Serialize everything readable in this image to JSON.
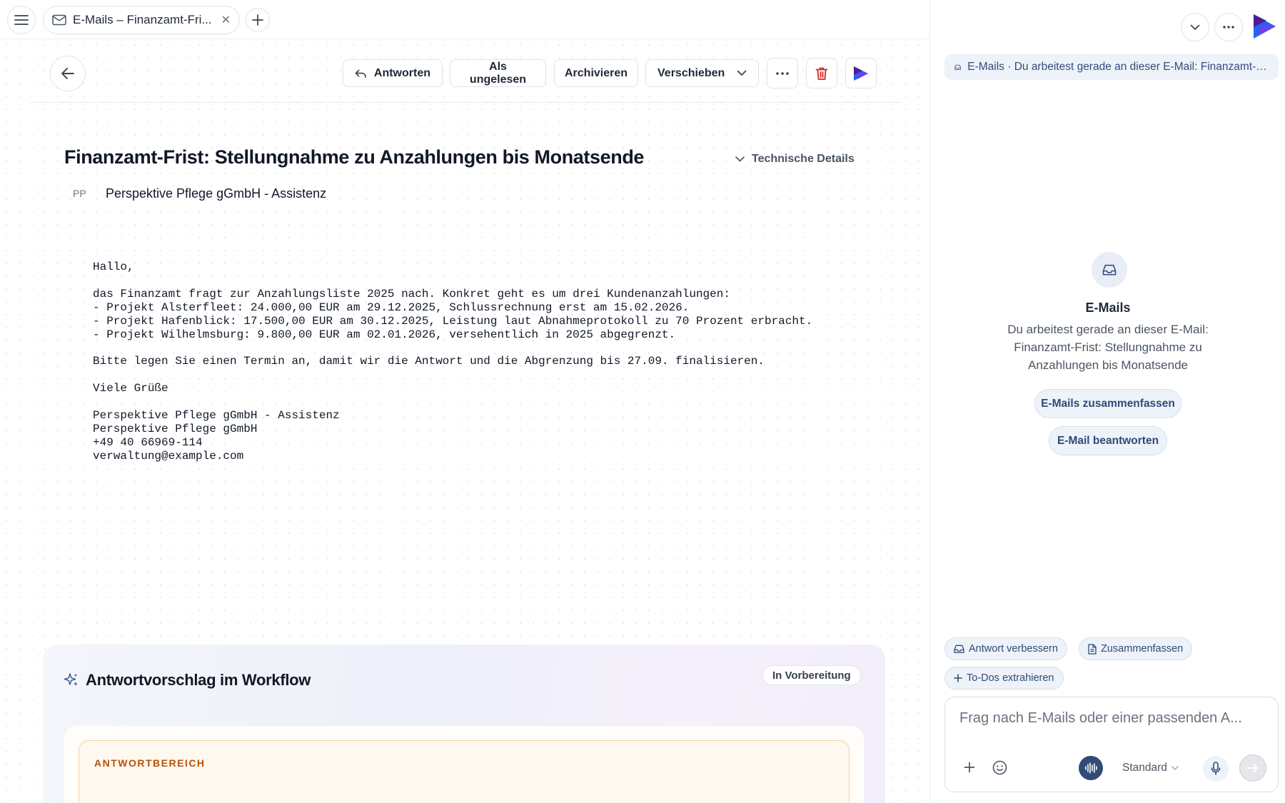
{
  "tabbar": {
    "tab_title": "E-Mails – Finanzamt-Fri..."
  },
  "toolbar": {
    "reply_label": "Antworten",
    "mark_unread_label": "Als ungelesen",
    "archive_label": "Archivieren",
    "move_label": "Verschieben"
  },
  "email": {
    "subject": "Finanzamt-Frist: Stellungnahme zu Anzahlungen bis Monatsende",
    "technical_details_label": "Technische Details",
    "sender_initials": "PP",
    "sender_name": "Perspektive Pflege gGmbH - Assistenz",
    "body": "Hallo,\n\ndas Finanzamt fragt zur Anzahlungsliste 2025 nach. Konkret geht es um drei Kundenanzahlungen:\n- Projekt Alsterfleet: 24.000,00 EUR am 29.12.2025, Schlussrechnung erst am 15.02.2026.\n- Projekt Hafenblick: 17.500,00 EUR am 30.12.2025, Leistung laut Abnahmeprotokoll zu 70 Prozent erbracht.\n- Projekt Wilhelmsburg: 9.800,00 EUR am 02.01.2026, versehentlich in 2025 abgegrenzt.\n\nBitte legen Sie einen Termin an, damit wir die Antwort und die Abgrenzung bis 27.09. finalisieren.\n\nViele Grüße\n\nPerspektive Pflege gGmbH - Assistenz\nPerspektive Pflege gGmbH\n+49 40 66969-114\nverwaltung@example.com"
  },
  "workflow": {
    "title": "Antwortvorschlag im Workflow",
    "status_badge": "In Vorbereitung",
    "area_label": "ANTWORTBEREICH"
  },
  "assistant": {
    "context_pill": "E-Mails · Du arbeitest gerade an dieser E-Mail: Finanzamt-Frist: Stellungnahme zu Anzahlungen bis Monatsende",
    "center_title": "E-Mails",
    "center_description": "Du arbeitest gerade an dieser E-Mail: Finanzamt-Frist: Stellungnahme zu Anzahlungen bis Monatsende",
    "suggestions": [
      "E-Mails zusammenfassen",
      "E-Mail beantworten"
    ],
    "chips": [
      "Antwort verbessern",
      "Zusammenfassen",
      "To-Dos extrahieren"
    ],
    "composer_placeholder": "Frag nach E-Mails oder einer passenden A...",
    "model_label": "Standard"
  },
  "colors": {
    "accent": "#2f4b76",
    "danger": "#dc2626",
    "brand_purple": "#5b21b6",
    "brand_blue": "#2563eb"
  }
}
